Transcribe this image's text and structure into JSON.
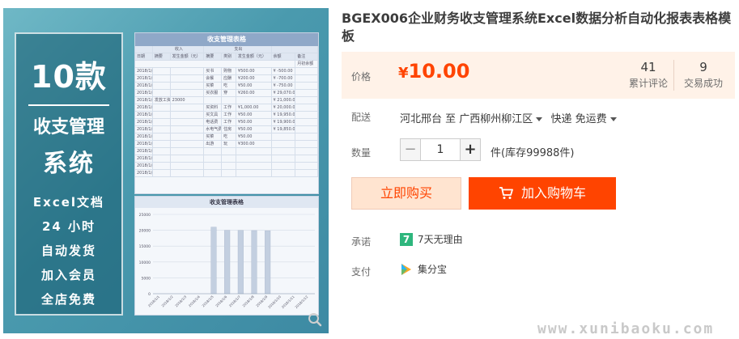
{
  "product_image": {
    "promo_count": "10款",
    "promo_line1": "收支管理",
    "promo_line2": "系统",
    "promo_features": [
      "Excel文档",
      "24 小时",
      "自动发货",
      "加入会员",
      "全店免费"
    ],
    "sheet_title": "收支管理表格",
    "sheet_group_headers": [
      "收入",
      "支出"
    ],
    "sheet_headers": [
      "日期",
      "摘要",
      "发生金额（元）",
      "摘要",
      "类别",
      "发生金额（元）",
      "余额",
      "备注"
    ],
    "sheet_first_remark": "月初余额",
    "sheet_rows": [
      [
        "2018/1/1",
        "",
        "",
        "买书",
        "购物",
        "¥500.00",
        "¥ -500.00",
        ""
      ],
      [
        "2018/1/2",
        "",
        "",
        "会餐",
        "应酬",
        "¥200.00",
        "¥ -700.00",
        ""
      ],
      [
        "2018/1/3",
        "",
        "",
        "买菜",
        "吃",
        "¥50.00",
        "¥ -750.00",
        ""
      ],
      [
        "2018/1/4",
        "",
        "",
        "买衣服",
        "穿",
        "¥260.00",
        "¥ 29,070.00",
        ""
      ],
      [
        "2018/1/5",
        "发放工资",
        "23000",
        "",
        "",
        "",
        "¥ 21,000.00",
        ""
      ],
      [
        "2018/1/6",
        "",
        "",
        "买资料",
        "工作",
        "¥1,000.00",
        "¥ 20,000.00",
        ""
      ],
      [
        "2018/1/7",
        "",
        "",
        "买文具",
        "工作",
        "¥50.00",
        "¥ 19,950.00",
        ""
      ],
      [
        "2018/1/8",
        "",
        "",
        "电话费",
        "工作",
        "¥50.00",
        "¥ 19,900.00",
        ""
      ],
      [
        "2018/1/9",
        "",
        "",
        "水电气费",
        "住房",
        "¥50.00",
        "¥ 19,850.00",
        ""
      ],
      [
        "2018/1/10",
        "",
        "",
        "买菜",
        "吃",
        "¥50.00",
        "",
        ""
      ],
      [
        "2018/1/11",
        "",
        "",
        "出游",
        "玩",
        "¥300.00",
        "",
        ""
      ],
      [
        "2018/1/12",
        "",
        "",
        "",
        "",
        "",
        "",
        ""
      ],
      [
        "2018/1/13",
        "",
        "",
        "",
        "",
        "",
        "",
        ""
      ],
      [
        "2018/1/14",
        "",
        "",
        "",
        "",
        "",
        "",
        ""
      ],
      [
        "2018/1/15",
        "",
        "",
        "",
        "",
        "",
        "",
        ""
      ]
    ]
  },
  "chart_data": {
    "type": "bar",
    "title": "收支管理表格",
    "categories": [
      "2018/1/1",
      "2018/1/2",
      "2018/1/3",
      "2018/1/4",
      "2018/1/5",
      "2018/1/6",
      "2018/1/7",
      "2018/1/8",
      "2018/1/9",
      "2018/1/10",
      "2018/1/11",
      "2018/1/12"
    ],
    "ylim": [
      0,
      25000
    ],
    "yticks": [
      0,
      5000,
      10000,
      15000,
      20000,
      25000
    ],
    "series": [
      {
        "values": [
          0,
          0,
          0,
          0,
          21000,
          20000,
          19950,
          19900,
          19850,
          0,
          0,
          0
        ]
      }
    ],
    "grid": true
  },
  "title": "BGEX006企业财务收支管理系统Excel数据分析自动化报表表格模板",
  "price_label": "价格",
  "price_currency": "¥",
  "price_value": "10.00",
  "stats": [
    {
      "number": "41",
      "label": "累计评论"
    },
    {
      "number": "9",
      "label": "交易成功"
    }
  ],
  "shipping": {
    "label": "配送",
    "from": "河北邢台 至",
    "to": "广西柳州柳江区",
    "method": "快递 免运费"
  },
  "quantity": {
    "label": "数量",
    "minus": "−",
    "value": "1",
    "plus": "+",
    "stock": "件(库存99988件)"
  },
  "buy_now_label": "立即购买",
  "add_cart_label": "加入购物车",
  "promise": {
    "label": "承诺",
    "badge": "7",
    "text": "7天无理由"
  },
  "payment": {
    "label": "支付",
    "text": "集分宝"
  },
  "watermark": "www.xunibaoku.com",
  "colors": {
    "accent": "#ff4400",
    "price_bg": "#fff2e8",
    "badge_green": "#2eb67d"
  }
}
